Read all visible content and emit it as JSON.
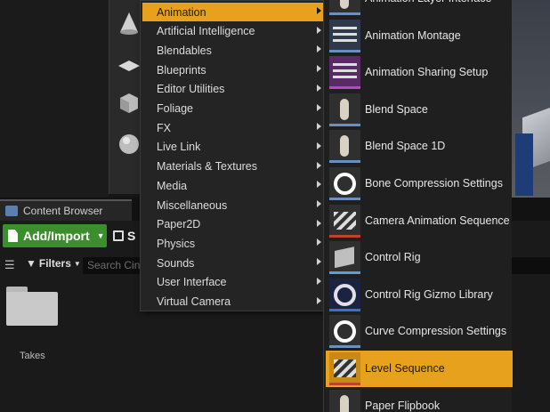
{
  "content_browser": {
    "tab_label": "Content Browser",
    "add_import_label": "Add/Import",
    "save_label": "S",
    "filters_label": "Filters",
    "search_placeholder": "Search Cin",
    "folder_label": "Takes"
  },
  "category_menu": {
    "items": [
      {
        "label": "Animation",
        "active": true
      },
      {
        "label": "Artificial Intelligence"
      },
      {
        "label": "Blendables"
      },
      {
        "label": "Blueprints"
      },
      {
        "label": "Editor Utilities"
      },
      {
        "label": "Foliage"
      },
      {
        "label": "FX"
      },
      {
        "label": "Live Link"
      },
      {
        "label": "Materials & Textures"
      },
      {
        "label": "Media"
      },
      {
        "label": "Miscellaneous"
      },
      {
        "label": "Paper2D"
      },
      {
        "label": "Physics"
      },
      {
        "label": "Sounds"
      },
      {
        "label": "User Interface"
      },
      {
        "label": "Virtual Camera"
      }
    ]
  },
  "asset_menu": {
    "items": [
      {
        "label": "Animation Layer Interface",
        "icon": "animation-layer-interface-icon",
        "band": "#6b8fbf"
      },
      {
        "label": "Animation Montage",
        "icon": "animation-montage-icon",
        "band": "#6b8fbf"
      },
      {
        "label": "Animation Sharing Setup",
        "icon": "animation-sharing-setup-icon",
        "band": "#b04cc0"
      },
      {
        "label": "Blend Space",
        "icon": "blend-space-icon",
        "band": "#6b8fbf"
      },
      {
        "label": "Blend Space 1D",
        "icon": "blend-space-1d-icon",
        "band": "#6b8fbf"
      },
      {
        "label": "Bone Compression Settings",
        "icon": "bone-compression-settings-icon",
        "band": "#6b8fbf"
      },
      {
        "label": "Camera Animation Sequence",
        "icon": "camera-animation-sequence-icon",
        "band": "#c0422e"
      },
      {
        "label": "Control Rig",
        "icon": "control-rig-icon",
        "band": "#5aa0d8"
      },
      {
        "label": "Control Rig Gizmo Library",
        "icon": "control-rig-gizmo-library-icon",
        "band": "#3a6fd0"
      },
      {
        "label": "Curve Compression Settings",
        "icon": "curve-compression-settings-icon",
        "band": "#6b8fbf"
      },
      {
        "label": "Level Sequence",
        "icon": "level-sequence-icon",
        "band": "#c0422e",
        "active": true
      },
      {
        "label": "Paper Flipbook",
        "icon": "paper-flipbook-icon",
        "band": "#6b8fbf"
      }
    ]
  }
}
